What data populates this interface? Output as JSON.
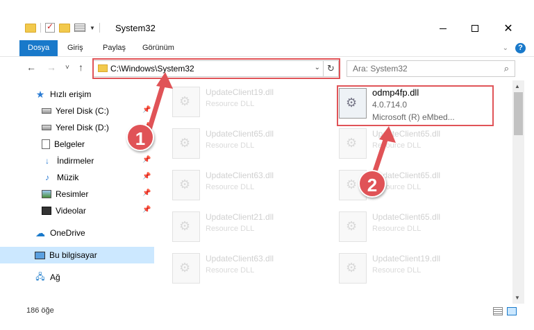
{
  "window": {
    "title": "System32",
    "minimize": "",
    "maximize": "",
    "close": "✕"
  },
  "ribbon": {
    "tabs": [
      "Dosya",
      "Giriş",
      "Paylaş",
      "Görünüm"
    ],
    "help": "?"
  },
  "nav": {
    "back": "←",
    "forward": "→",
    "recent": "˅",
    "up": "↑",
    "address": "C:\\Windows\\System32",
    "refresh": "↻",
    "search_placeholder": "Ara: System32"
  },
  "sidebar": {
    "items": [
      {
        "label": "Hızlı erişim",
        "icon": "star-icon"
      },
      {
        "label": "Yerel Disk (C:)",
        "icon": "drive-icon",
        "pinned": true
      },
      {
        "label": "Yerel Disk (D:)",
        "icon": "drive-icon",
        "pinned": true
      },
      {
        "label": "Belgeler",
        "icon": "document-icon",
        "pinned": true
      },
      {
        "label": "İndirmeler",
        "icon": "download-icon",
        "pinned": true
      },
      {
        "label": "Müzik",
        "icon": "music-icon",
        "pinned": true
      },
      {
        "label": "Resimler",
        "icon": "pictures-icon",
        "pinned": true
      },
      {
        "label": "Videolar",
        "icon": "videos-icon",
        "pinned": true
      },
      {
        "label": "OneDrive",
        "icon": "cloud-icon"
      },
      {
        "label": "Bu bilgisayar",
        "icon": "computer-icon",
        "selected": true
      },
      {
        "label": "Ağ",
        "icon": "network-icon"
      }
    ]
  },
  "files": {
    "left": [
      {
        "name": "UpdateClient19.dll",
        "type": "Resource DLL"
      },
      {
        "name": "UpdateClient65.dll",
        "type": "Resource DLL"
      },
      {
        "name": "UpdateClient63.dll",
        "type": "Resource DLL"
      },
      {
        "name": "UpdateClient21.dll",
        "type": "Resource DLL"
      },
      {
        "name": "UpdateClient63.dll",
        "type": "Resource DLL"
      }
    ],
    "highlighted": {
      "name": "odmp4fp.dll",
      "version": "4.0.714.0",
      "description": "Microsoft (R) eMbed..."
    },
    "right": [
      {
        "name": "UpdateClient65.dll",
        "type": "Resource DLL"
      },
      {
        "name": "UpdateClient65.dll",
        "type": "Resource DLL"
      },
      {
        "name": "UpdateClient65.dll",
        "type": "Resource DLL"
      },
      {
        "name": "UpdateClient19.dll",
        "type": "Resource DLL"
      }
    ]
  },
  "status": {
    "count": "186 öğe"
  },
  "annotations": {
    "badge1": "1",
    "badge2": "2",
    "color": "#e05357"
  },
  "colors": {
    "accent": "#1979ca",
    "selected_bg": "#cce8ff"
  }
}
